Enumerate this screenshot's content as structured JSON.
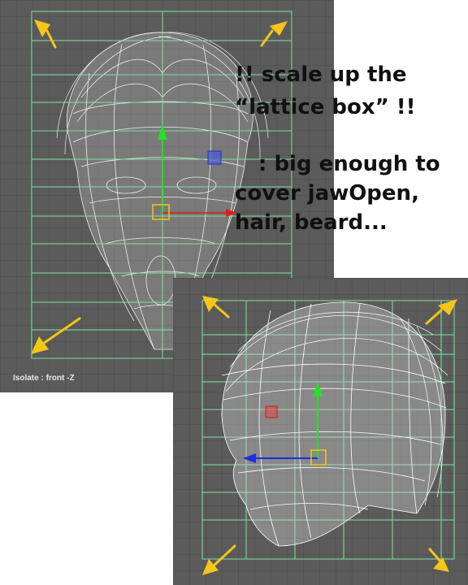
{
  "front_view": {
    "label": "Isolate : front -Z"
  },
  "annotation": {
    "line1": "!! scale up the",
    "line2": "“lattice box” !!",
    "line3": ": big enough to",
    "line4": "cover jawOpen,",
    "line5": "hair, beard..."
  },
  "colors": {
    "viewport_bg": "#5b5b5b",
    "lattice_line": "#7fe3a4",
    "arrow": "#f5c518",
    "manip_y": "#27e027",
    "manip_x": "#e01b1b",
    "manip_z": "#1b2fe0"
  },
  "icons": [
    "scale-arrow-icon",
    "move-manipulator-icon"
  ]
}
